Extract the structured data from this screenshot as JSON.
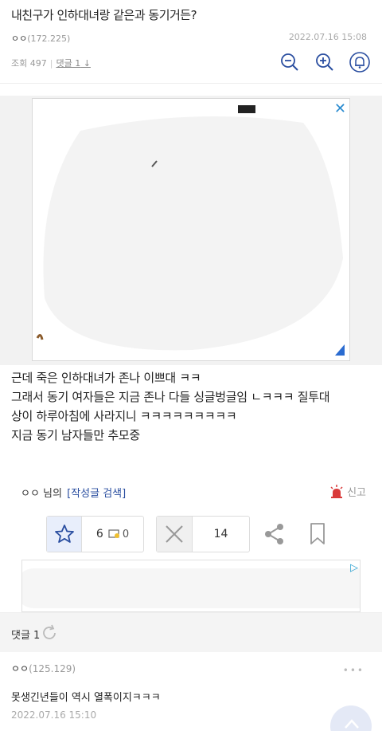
{
  "post": {
    "title": "내친구가 인하대녀랑 같은과 동기거든?",
    "author": "ㅇㅇ",
    "ip": "(172.225)",
    "date": "2022.07.16 15:08",
    "views_label": "조회 497",
    "comments_link": "댓글 1"
  },
  "tools": {
    "zoom_out": "zoom-out-icon",
    "zoom_in": "zoom-in-icon",
    "notify": "bell-icon"
  },
  "body": {
    "lines": [
      "근데 죽은 인하대녀가 존나 이쁘대 ㅋㅋ",
      "그래서 동기 여자들은 지금 존나 다들 싱글벙글임 ㄴㅋㅋㅋ 질투대",
      "상이 하루아침에 사라지니 ㅋㅋㅋㅋㅋㅋㅋㅋㅋ",
      "지금 동기 남자들만 추모중"
    ]
  },
  "writer": {
    "name": "ㅇㅇ 님의",
    "search_label": "[작성글 검색]",
    "report_label": "신고"
  },
  "votes": {
    "up_count": "6",
    "fix_count": "0",
    "down_count": "14"
  },
  "comments_section": {
    "label": "댓글 1"
  },
  "comment": {
    "author": "ㅇㅇ",
    "ip": "(125.129)",
    "text": "못생긴년들이 역시 열폭이지ㅋㅋㅋ",
    "date": "2022.07.16 15:10",
    "more": "•••"
  },
  "colors": {
    "accent_blue": "#2a4ea0",
    "report_red": "#d93a3a",
    "vote_up_bg": "#e8eefb"
  }
}
